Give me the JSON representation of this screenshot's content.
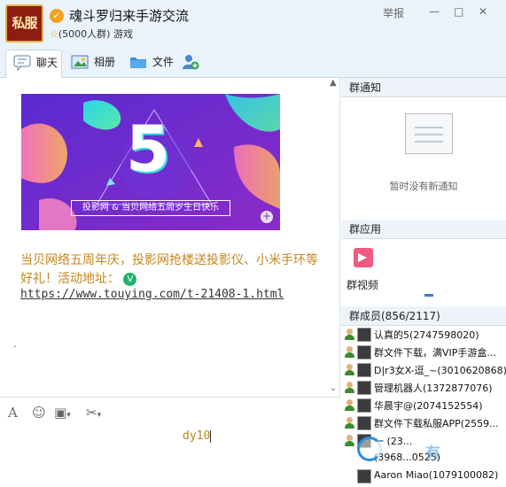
{
  "header": {
    "logo_text": "私服",
    "group_name": "魂斗罗归来手游交流",
    "subtitle": "(5000人群) 游戏",
    "report": "举报",
    "minimize": "—",
    "maximize": "□",
    "close": "✕"
  },
  "tabs": [
    {
      "label": "聊天",
      "icon": "chat-bubble-icon"
    },
    {
      "label": "相册",
      "icon": "photo-icon"
    },
    {
      "label": "文件",
      "icon": "folder-icon"
    },
    {
      "label": "",
      "icon": "add-member-icon"
    }
  ],
  "chat": {
    "banner": {
      "number": "5",
      "caption": "投影网 & 当贝网络五周岁生日快乐"
    },
    "message_text": "当贝网络五周年庆，投影网抢楼送投影仪、小米手环等好礼！活动地址：",
    "message_link": "https://www.touying.com/t-21408-1.html",
    "dot": "."
  },
  "input": {
    "typed_text": "dy10"
  },
  "right_panel": {
    "notice_title": "群通知",
    "notice_empty": "暂时没有新通知",
    "apps_title": "群应用",
    "app_label": "群视频",
    "members_title": "群成员(856/2117)",
    "members": [
      "认真的5(2747598020)",
      "群文件下载，满VIP手游盒...",
      "D|r3女X-逗_~(3010620868)",
      "管理机器人(1372877076)",
      "华晨宇@(2074152554)",
      "群文件下载私服APP(2559...",
      "一 (23...",
      "(3968...0525)",
      "Aaron Miao(1079100082)"
    ]
  },
  "overlay": {
    "watermark": "有"
  },
  "colors": {
    "accent": "#3d7bd0",
    "message": "#c7851c",
    "header_bg": "#eaf2fb"
  }
}
